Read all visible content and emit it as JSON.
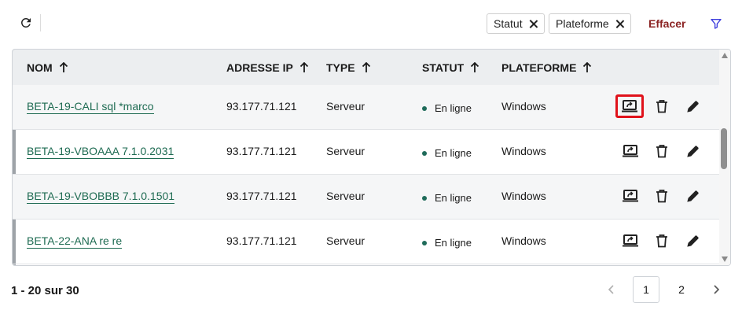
{
  "toolbar": {
    "chips": [
      {
        "label": "Statut"
      },
      {
        "label": "Plateforme"
      }
    ],
    "clear_label": "Effacer"
  },
  "table": {
    "headers": [
      "NOM",
      "ADRESSE IP",
      "TYPE",
      "STATUT",
      "PLATEFORME"
    ],
    "rows": [
      {
        "name": "BETA-19-CALI sql *marco",
        "ip": "93.177.71.121",
        "type": "Serveur",
        "status": "En ligne",
        "platform": "Windows"
      },
      {
        "name": "BETA-19-VBOAAA 7.1.0.2031",
        "ip": "93.177.71.121",
        "type": "Serveur",
        "status": "En ligne",
        "platform": "Windows"
      },
      {
        "name": "BETA-19-VBOBBB 7.1.0.1501",
        "ip": "93.177.71.121",
        "type": "Serveur",
        "status": "En ligne",
        "platform": "Windows"
      },
      {
        "name": "BETA-22-ANA re re",
        "ip": "93.177.71.121",
        "type": "Serveur",
        "status": "En ligne",
        "platform": "Windows"
      }
    ]
  },
  "pagination": {
    "range_text": "1 - 20 sur 30",
    "pages": [
      "1",
      "2"
    ],
    "current_page": "1"
  },
  "colors": {
    "link": "#1e6b52",
    "clear": "#8b2323",
    "highlight": "#e0121b",
    "filter": "#3b3bdc"
  },
  "icons": {
    "refresh": "refresh-icon",
    "filter": "filter-icon",
    "connect": "remote-desktop-icon",
    "delete": "trash-icon",
    "edit": "pencil-icon"
  }
}
